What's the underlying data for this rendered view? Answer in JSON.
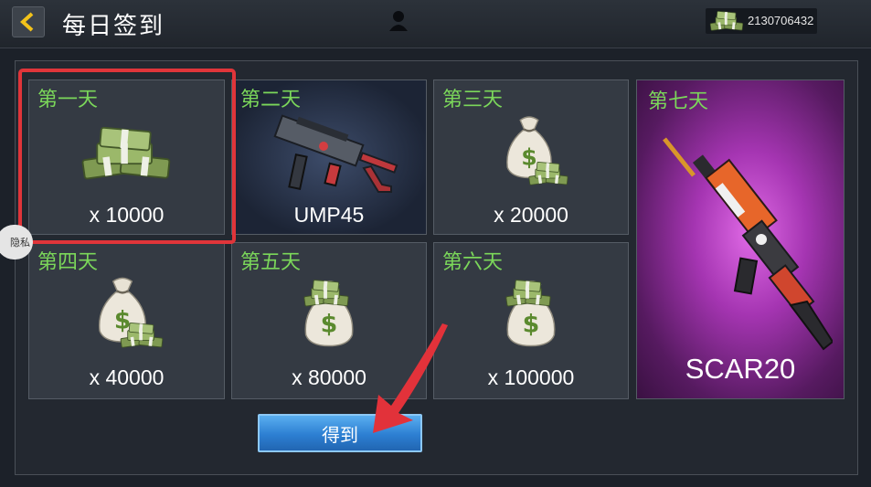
{
  "header": {
    "title": "每日签到",
    "currency_amount": "2130706432"
  },
  "rewards": [
    {
      "day": "第一天",
      "quantity": "x 10000"
    },
    {
      "day": "第二天",
      "item": "UMP45"
    },
    {
      "day": "第三天",
      "quantity": "x 20000"
    },
    {
      "day": "第四天",
      "quantity": "x 40000"
    },
    {
      "day": "第五天",
      "quantity": "x 80000"
    },
    {
      "day": "第六天",
      "quantity": "x 100000"
    },
    {
      "day": "第七天",
      "item": "SCAR20"
    }
  ],
  "actions": {
    "get_label": "得到"
  },
  "privacy_label": "隐私",
  "colors": {
    "day_label": "#7bd75a",
    "highlight": "#e0353a",
    "button": "#2d7fd2",
    "day7_bg": "#a535b2"
  },
  "icons": [
    "back-arrow-icon",
    "profile-icon",
    "cash-stack-icon",
    "money-bag-icon",
    "ump45-gun-icon",
    "scar20-rifle-icon"
  ]
}
